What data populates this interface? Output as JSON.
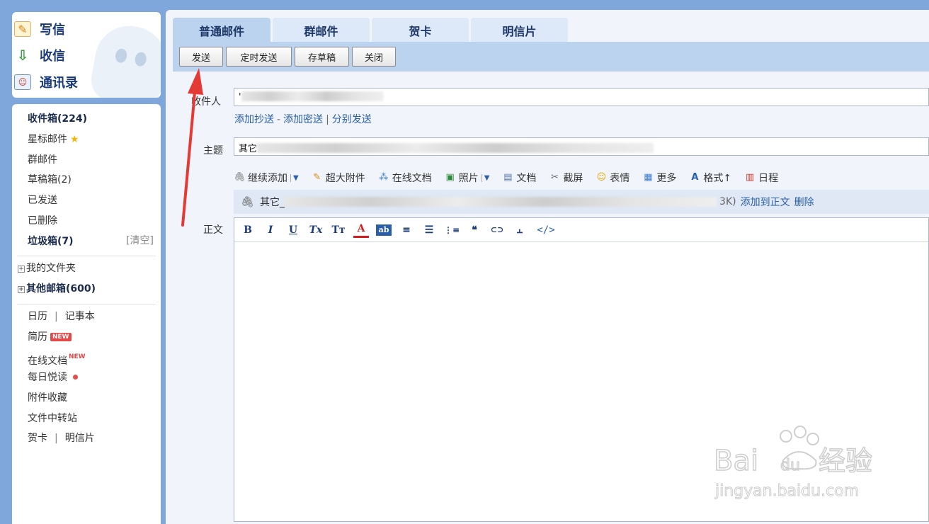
{
  "quick_links": {
    "write": "写信",
    "inbox": "收信",
    "contacts": "通讯录"
  },
  "folders": {
    "inbox": "收件箱(224)",
    "starred": "星标邮件",
    "group": "群邮件",
    "drafts": "草稿箱(2)",
    "sent": "已发送",
    "deleted": "已删除",
    "spam": "垃圾箱(7)",
    "clear_spam": "[清空]",
    "my_folders": "我的文件夹",
    "other_mailboxes": "其他邮箱(600)"
  },
  "apps": {
    "calendar": "日历",
    "separator": "|",
    "notes": "记事本",
    "resume": "简历",
    "new_badge": "NEW",
    "online_docs": "在线文档",
    "daily_read": "每日悦读",
    "attachment_fav": "附件收藏",
    "file_transfer": "文件中转站",
    "card": "贺卡",
    "postcard": "明信片"
  },
  "tabs": [
    "普通邮件",
    "群邮件",
    "贺卡",
    "明信片"
  ],
  "toolbar": {
    "send": "发送",
    "schedule": "定时发送",
    "save_draft": "存草稿",
    "close": "关闭"
  },
  "form": {
    "recipient_label": "收件人",
    "recipient_value": "'",
    "add_cc": "添加抄送",
    "dash": "-",
    "add_bcc": "添加密送",
    "bar": "|",
    "separate_send": "分别发送",
    "subject_label": "主题",
    "subject_value": "其它",
    "body_label": "正文"
  },
  "attachments_bar": {
    "continue_add": "继续添加",
    "large_attachment": "超大附件",
    "online_doc": "在线文档",
    "photo": "照片",
    "document": "文档",
    "screenshot": "截屏",
    "emoji": "表情",
    "more": "更多",
    "format": "格式↑",
    "schedule": "日程"
  },
  "attached_file": {
    "name": "其它_",
    "size": "3K)",
    "add_to_body": "添加到正文",
    "delete": "删除"
  },
  "editor_tools": [
    "B",
    "I",
    "U",
    "Tx",
    "Tт",
    "A",
    "ab",
    "≡",
    "☰",
    "⋮≡",
    "❝",
    "⊂⊃",
    "⫠",
    "</>"
  ],
  "watermark": {
    "brand": "Bai",
    "brand_mid": "du",
    "brand_cn": "经验",
    "url": "jingyan.baidu.com"
  },
  "colors": {
    "accent_blue": "#2a5ea8",
    "arrow_red": "#e53935",
    "tab_active": "#bcd3f0"
  }
}
